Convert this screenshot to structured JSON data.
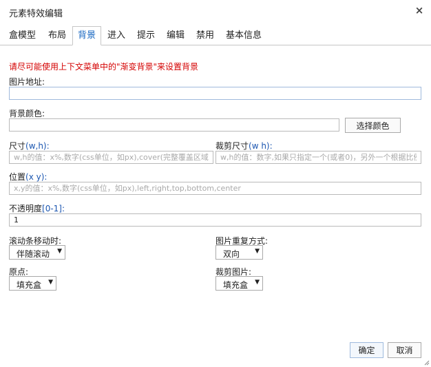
{
  "dialog": {
    "title": "元素特效编辑",
    "close_glyph": "×"
  },
  "tabs": [
    {
      "label": "盒模型",
      "active": false
    },
    {
      "label": "布局",
      "active": false
    },
    {
      "label": "背景",
      "active": true
    },
    {
      "label": "进入",
      "active": false
    },
    {
      "label": "提示",
      "active": false
    },
    {
      "label": "编辑",
      "active": false
    },
    {
      "label": "禁用",
      "active": false
    },
    {
      "label": "基本信息",
      "active": false
    }
  ],
  "notice": "请尽可能使用上下文菜单中的\"渐变背景\"来设置背景",
  "fields": {
    "image_url": {
      "label": "图片地址:",
      "value": ""
    },
    "bg_color": {
      "label": "背景颜色:",
      "value": "",
      "button": "选择颜色"
    },
    "size": {
      "label_main": "尺寸",
      "label_hint": "(w,h):",
      "placeholder": "w,h的值：x%,数字(css单位，如px),cover(完整覆盖区域),contain(完整显示图像)"
    },
    "crop_size": {
      "label_main": "裁剪尺寸",
      "label_hint": "(w h):",
      "placeholder": "w,h的值：数字,如果只指定一个(或者0)，另外一个根据比例计算"
    },
    "position": {
      "label_main": "位置",
      "label_hint": "(x y):",
      "placeholder": "x,y的值：x%,数字(css单位，如px),left,right,top,bottom,center"
    },
    "opacity": {
      "label_main": "不透明度",
      "label_hint": "[0-1]:",
      "value": "1"
    },
    "scroll": {
      "label": "滚动条移动时:",
      "value": "伴随滚动"
    },
    "repeat": {
      "label": "图片重复方式:",
      "value": "双向"
    },
    "origin": {
      "label": "原点:",
      "value": "填充盒"
    },
    "clip": {
      "label": "裁剪图片:",
      "value": "填充盒"
    }
  },
  "footer": {
    "ok": "确定",
    "cancel": "取消"
  },
  "colors": {
    "accent": "#1565c0",
    "notice": "#d40000"
  }
}
